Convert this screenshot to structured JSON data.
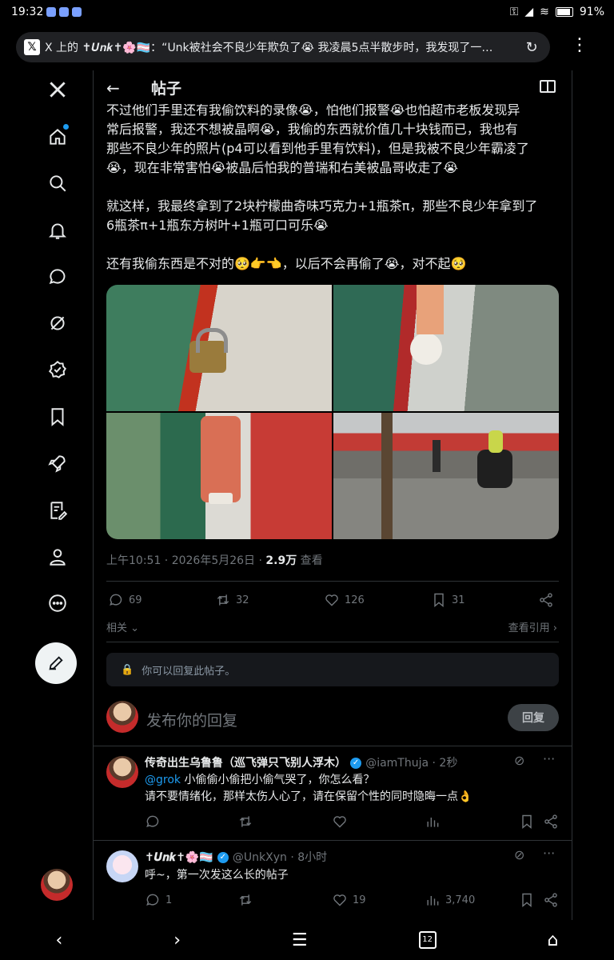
{
  "status_bar": {
    "time": "19:32",
    "battery": "91%"
  },
  "browser": {
    "tab_title": "X 上的 ✝𝑼𝒏𝒌✝🌸🏳️‍⚧️：“Unk被社会不良少年欺负了😭 我凌晨5点半散步时，我发现了一…"
  },
  "header": {
    "title": "帖子"
  },
  "post": {
    "lines": [
      "不过他们手里还有我偷饮料的录像😭，怕他们报警😭也怕超市老板发现异",
      "常后报警，我还不想被晶啊😭，我偷的东西就价值几十块钱而已，我也有",
      "那些不良少年的照片(p4可以看到他手里有饮料)，但是我被不良少年霸凌了",
      "😭，现在非常害怕😭被晶后怕我的普瑞和右美被晶哥收走了😭"
    ],
    "para2": [
      "就这样，我最终拿到了2块柠檬曲奇味巧克力+1瓶茶π，那些不良少年拿到了",
      "6瓶茶π+1瓶东方树叶+1瓶可口可乐😭"
    ],
    "para3": "还有我偷东西是不对的🥺👉👈，以后不会再偷了😭，对不起🥺",
    "time": "上午10:51 · 2026年5月26日 · ",
    "views": "2.9万",
    "views_label": " 查看",
    "replies": "69",
    "reposts": "32",
    "likes": "126",
    "bookmarks": "31",
    "related": "相关",
    "quotes": "查看引用"
  },
  "reply_notice": "你可以回复此帖子。",
  "composer": {
    "placeholder": "发布你的回复",
    "button": "回复"
  },
  "replies": [
    {
      "name": "传奇出生乌鲁鲁（巡飞弹只飞别人浮木）",
      "handle": "@iamThuja · 2秒",
      "mention": "@grok",
      "text1": " 小偷偷小偷把小偷气哭了，你怎么看？",
      "text2": "请不要情绪化，那样太伤人心了，请在保留个性的同时隐晦一点👌"
    },
    {
      "name": "✝𝑼𝒏𝒌✝🌸🏳️‍⚧️",
      "handle": "@UnkXyn · 8小时",
      "text1": "呼~，第一次发这么长的帖子",
      "replies": "1",
      "likes": "19",
      "views": "3,740"
    }
  ],
  "bottom_nav": {
    "tabs": "12"
  }
}
